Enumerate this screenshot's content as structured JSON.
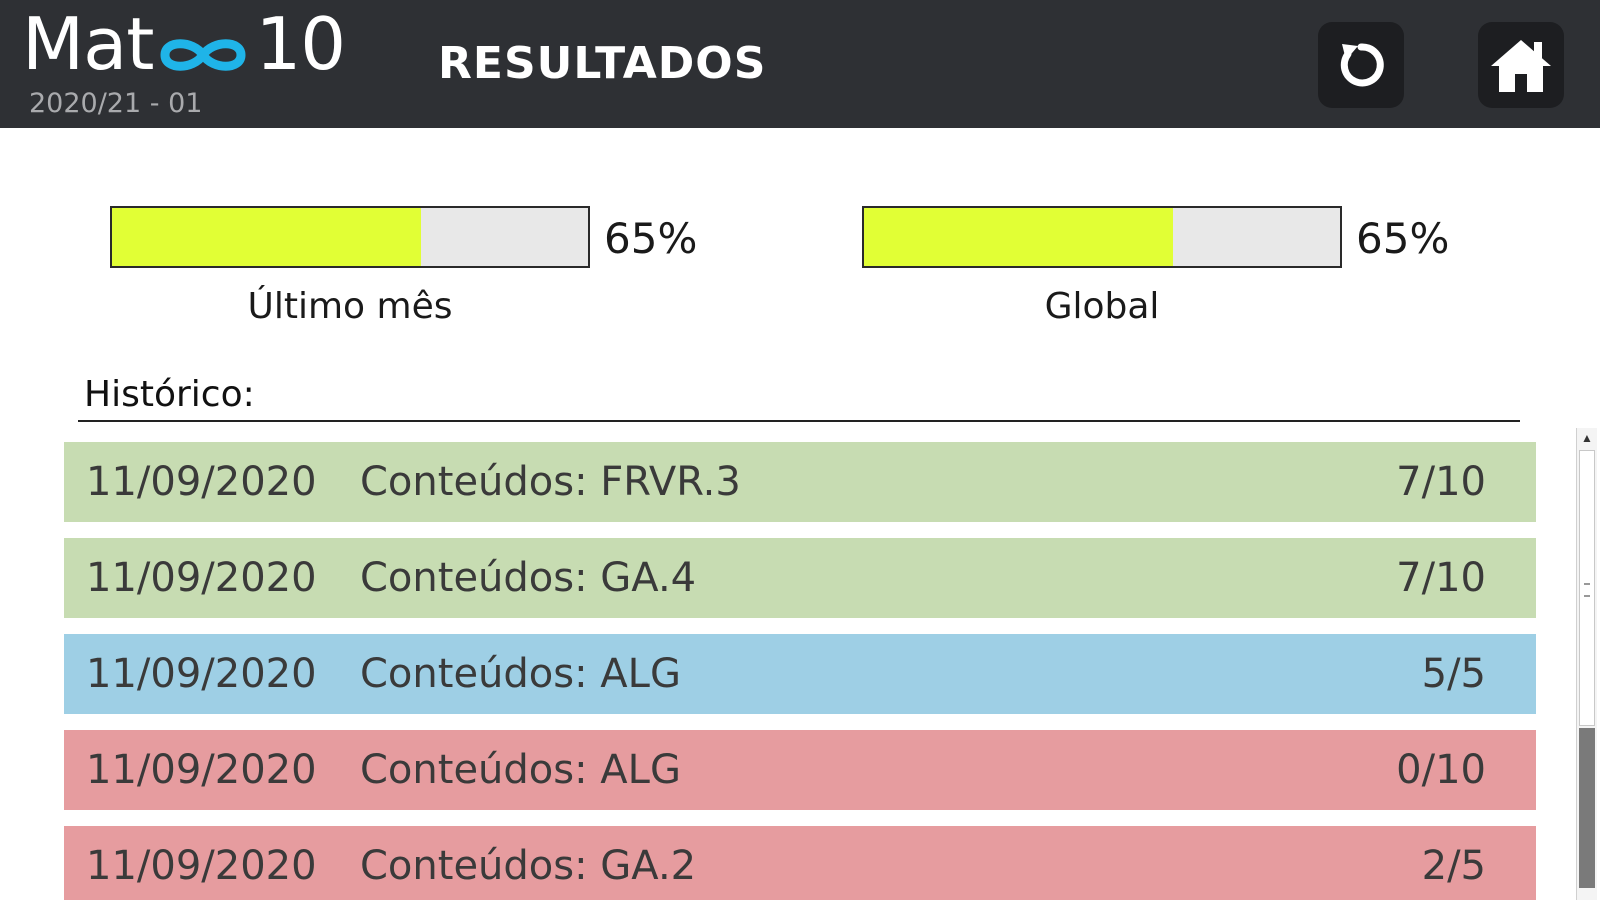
{
  "header": {
    "logo_prefix": "Mat",
    "logo_suffix": "10",
    "version": "2020/21 - 01",
    "title": "RESULTADOS",
    "refresh_icon": "refresh-icon",
    "home_icon": "home-icon"
  },
  "progress": {
    "last_month": {
      "label": "Último mês",
      "percent_text": "65%",
      "fraction": 0.65
    },
    "global": {
      "label": "Global",
      "percent_text": "65%",
      "fraction": 0.65
    }
  },
  "history": {
    "label": "Histórico:",
    "rows": [
      {
        "date": "11/09/2020",
        "content": "Conteúdos: FRVR.3",
        "score": "7/10",
        "status": "green"
      },
      {
        "date": "11/09/2020",
        "content": "Conteúdos: GA.4",
        "score": "7/10",
        "status": "green"
      },
      {
        "date": "11/09/2020",
        "content": "Conteúdos: ALG",
        "score": "5/5",
        "status": "blue"
      },
      {
        "date": "11/09/2020",
        "content": "Conteúdos: ALG",
        "score": "0/10",
        "status": "red"
      },
      {
        "date": "11/09/2020",
        "content": "Conteúdos: GA.2",
        "score": "2/5",
        "status": "red"
      }
    ]
  },
  "colors": {
    "header_bg": "#2e3034",
    "progress_fill": "#e1ff35",
    "green": "#c7dcb2",
    "blue": "#9ecfe5",
    "red": "#e69c9f"
  }
}
